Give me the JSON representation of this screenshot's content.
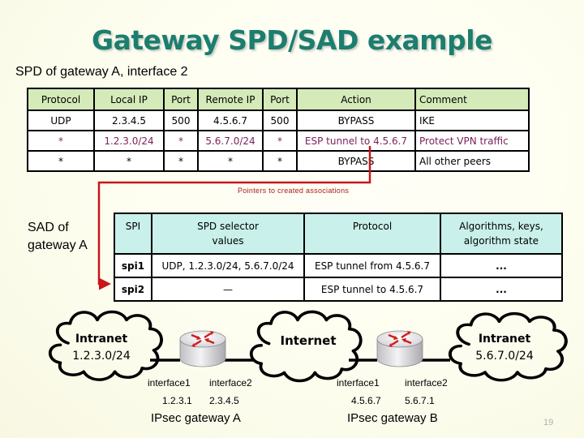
{
  "title": "Gateway SPD/SAD example",
  "spd": {
    "caption": "SPD of gateway A, interface 2",
    "columns": [
      "Protocol",
      "Local IP",
      "Port",
      "Remote IP",
      "Port",
      "Action",
      "Comment"
    ],
    "rows": [
      [
        "UDP",
        "2.3.4.5",
        "500",
        "4.5.6.7",
        "500",
        "BYPASS",
        "IKE"
      ],
      [
        "*",
        "1.2.3.0/24",
        "*",
        "5.6.7.0/24",
        "*",
        "ESP tunnel to 4.5.6.7",
        "Protect VPN traffic"
      ],
      [
        "*",
        "*",
        "*",
        "*",
        "*",
        "BYPASS",
        "All other peers"
      ]
    ],
    "highlight_color": "#7a1f5a",
    "header_color": "#d4eab9"
  },
  "pointer": {
    "label": "Pointers to created associations",
    "color": "#c8161b"
  },
  "sad": {
    "caption_line1": "SAD of",
    "caption_line2": "gateway A",
    "columns": [
      "SPI",
      "SPD selector values",
      "Protocol",
      "Algorithms, keys, algorithm state"
    ],
    "header_lines": [
      [
        "SPI"
      ],
      [
        "SPD selector",
        "values"
      ],
      [
        "Protocol"
      ],
      [
        "Algorithms, keys,",
        "algorithm state"
      ]
    ],
    "rows": [
      [
        "spi1",
        "UDP, 1.2.3.0/24, 5.6.7.0/24",
        "ESP tunnel from 4.5.6.7",
        "..."
      ],
      [
        "spi2",
        "—",
        "ESP tunnel to 4.5.6.7",
        "..."
      ]
    ],
    "header_color": "#c9f0ea"
  },
  "network": {
    "intranet_a": {
      "name": "Intranet",
      "subnet": "1.2.3.0/24"
    },
    "internet": {
      "name": "Internet"
    },
    "intranet_b": {
      "name": "Intranet",
      "subnet": "5.6.7.0/24"
    },
    "gateway_a": {
      "name": "IPsec gateway A",
      "if1_name": "interface1",
      "if1_ip": "1.2.3.1",
      "if2_name": "interface2",
      "if2_ip": "2.3.4.5"
    },
    "gateway_b": {
      "name": "IPsec gateway B",
      "if1_name": "interface1",
      "if1_ip": "4.5.6.7",
      "if2_name": "interface2",
      "if2_ip": "5.6.7.1"
    }
  },
  "page_number": "19"
}
